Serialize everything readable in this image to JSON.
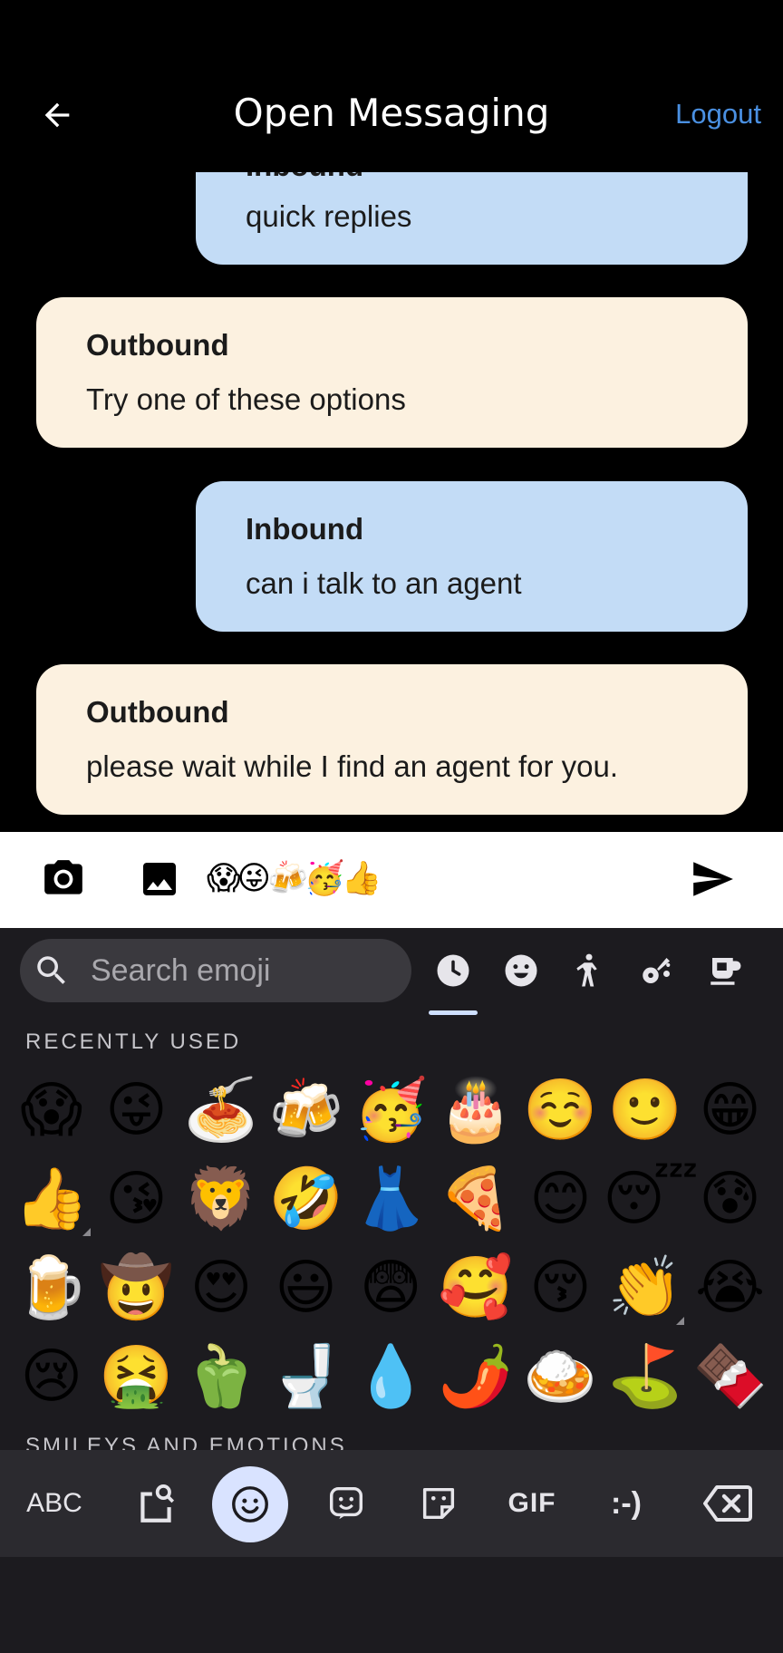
{
  "header": {
    "title": "Open Messaging",
    "logout_label": "Logout",
    "back_icon": "arrow-back-icon"
  },
  "messages": [
    {
      "direction": "inbound",
      "sender": "Inbound",
      "text": "quick replies"
    },
    {
      "direction": "outbound",
      "sender": "Outbound",
      "text": "Try one of these options"
    },
    {
      "direction": "inbound",
      "sender": "Inbound",
      "text": "can i talk to an agent"
    },
    {
      "direction": "outbound",
      "sender": "Outbound",
      "text": "please wait while I find an agent for you."
    }
  ],
  "compose": {
    "camera_icon": "camera-icon",
    "gallery_icon": "image-icon",
    "text": "😱😜🍻🥳👍",
    "send_icon": "send-icon"
  },
  "emoji_keyboard": {
    "search_placeholder": "Search emoji",
    "categories": [
      "recent-icon",
      "smiley-icon",
      "person-icon",
      "activity-icon",
      "food-icon"
    ],
    "recently_used_label": "RECENTLY USED",
    "recently_used": [
      "😱",
      "😜",
      "🍝",
      "🍻",
      "🥳",
      "🎂",
      "☺️",
      "🙂",
      "😁",
      "👍",
      "😘",
      "🦁",
      "🤣",
      "👗",
      "🍕",
      "😊",
      "😴",
      "😰",
      "🍺",
      "🤠",
      "😍",
      "😃",
      "😨",
      "🥰",
      "😚",
      "👏",
      "😭",
      "😢",
      "🤮",
      "🫑",
      "🚽",
      "💧",
      "🌶️",
      "🍛",
      "⛳",
      "🍫"
    ],
    "next_section_label": "SMILEYS AND EMOTIONS",
    "toolbar": {
      "abc_label": "ABC",
      "gif_label": "GIF",
      "emoticon_label": ":-)"
    }
  },
  "colors": {
    "inbound_bubble": "#c3dcf6",
    "outbound_bubble": "#fcf1e0",
    "accent": "#4a90e2",
    "keyboard_bg": "#1c1b1f"
  }
}
